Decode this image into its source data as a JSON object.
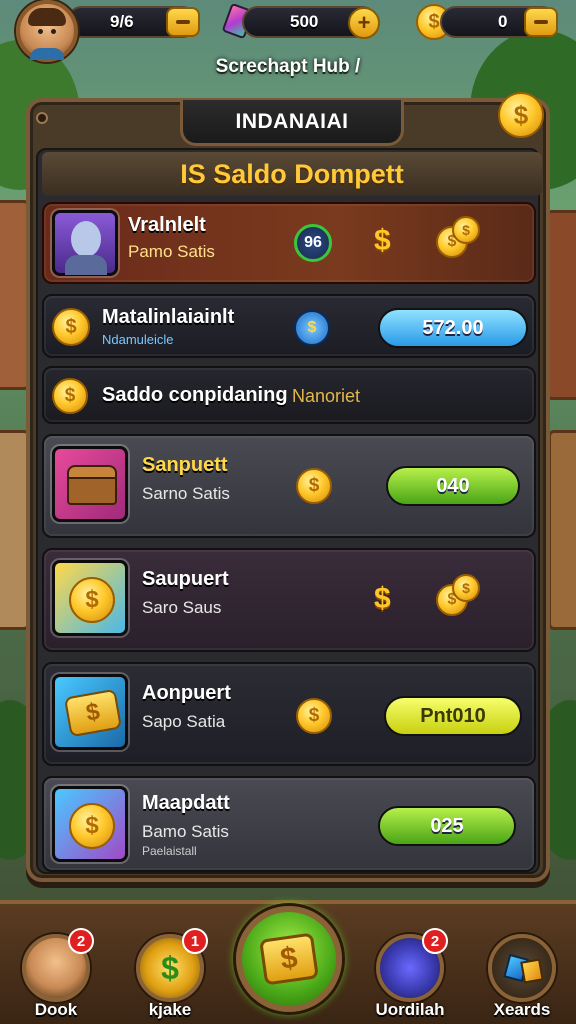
{
  "topbar": {
    "stat1": "9/6",
    "stat2": "500",
    "stat3": "0"
  },
  "hub_title": "Screchapt Hub /",
  "panel": {
    "tab": "INDANAIAI",
    "heading": "IS Saldo Dompett",
    "coin_symbol": "$"
  },
  "rows": [
    {
      "title": "Vralnlelt",
      "sub": "Pamo Satis",
      "badge": "96",
      "glyph": "$"
    },
    {
      "title": "Matalinlaiainlt",
      "sub": "Ndamuleicle",
      "value": "572.00"
    },
    {
      "title": "Saddo conpidaning",
      "extra": "Nanoriet"
    },
    {
      "title": "Sanpuett",
      "sub": "Sarno Satis",
      "button": "040"
    },
    {
      "title": "Saupuert",
      "sub": "Saro Saus",
      "glyph": "$"
    },
    {
      "title": "Aonpuert",
      "sub": "Sapo Satia",
      "button": "Pnt010"
    },
    {
      "title": "Maapdatt",
      "sub": "Bamo Satis",
      "small": "Paelaistall",
      "button": "025"
    }
  ],
  "nav": [
    {
      "label": "Dook",
      "badge": "2"
    },
    {
      "label": "kjake",
      "badge": "1"
    },
    {
      "label": "Uordilah",
      "badge": "2"
    },
    {
      "label": "Xeards"
    }
  ],
  "colors": {
    "accent_gold": "#ffc93a",
    "button_green": "#4aa418",
    "button_blue": "#2a9ae8",
    "button_yellow": "#c8d010"
  }
}
